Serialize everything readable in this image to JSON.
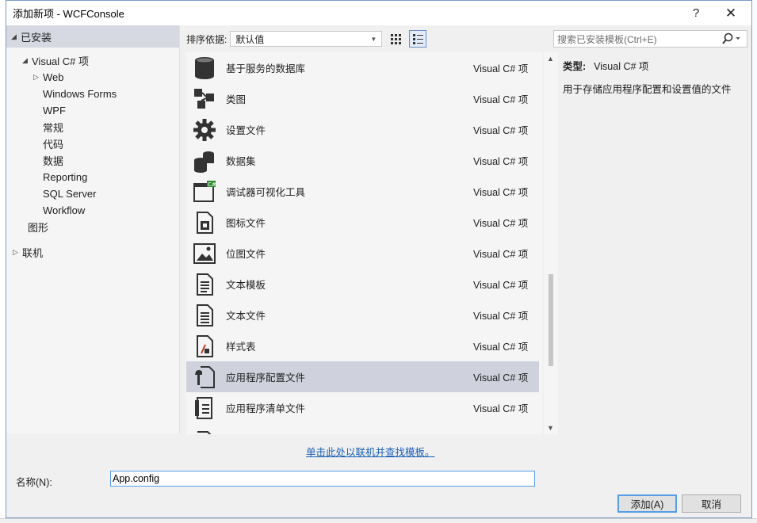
{
  "window": {
    "title": "添加新项 - WCFConsole",
    "help": "?",
    "close": "✕"
  },
  "tree": {
    "installed": "已安装",
    "visual_csharp": "Visual C# 项",
    "children": [
      "Web",
      "Windows Forms",
      "WPF",
      "常规",
      "代码",
      "数据",
      "Reporting",
      "SQL Server",
      "Workflow"
    ],
    "graphics": "图形",
    "online": "联机"
  },
  "sortbar": {
    "label": "排序依据:",
    "value": "默认值"
  },
  "search": {
    "placeholder": "搜索已安装模板(Ctrl+E)"
  },
  "items": [
    {
      "name": "基于服务的数据库",
      "type": "Visual C# 项",
      "icon": "database-icon"
    },
    {
      "name": "类图",
      "type": "Visual C# 项",
      "icon": "class-diagram-icon"
    },
    {
      "name": "设置文件",
      "type": "Visual C# 项",
      "icon": "gear-icon"
    },
    {
      "name": "数据集",
      "type": "Visual C# 项",
      "icon": "dataset-icon"
    },
    {
      "name": "调试器可视化工具",
      "type": "Visual C# 项",
      "icon": "visualizer-icon"
    },
    {
      "name": "图标文件",
      "type": "Visual C# 项",
      "icon": "icon-file-icon"
    },
    {
      "name": "位图文件",
      "type": "Visual C# 项",
      "icon": "bitmap-file-icon"
    },
    {
      "name": "文本模板",
      "type": "Visual C# 项",
      "icon": "text-template-icon"
    },
    {
      "name": "文本文件",
      "type": "Visual C# 项",
      "icon": "text-file-icon"
    },
    {
      "name": "样式表",
      "type": "Visual C# 项",
      "icon": "stylesheet-icon"
    },
    {
      "name": "应用程序配置文件",
      "type": "Visual C# 项",
      "icon": "app-config-icon",
      "selected": true
    },
    {
      "name": "应用程序清单文件",
      "type": "Visual C# 项",
      "icon": "manifest-icon"
    }
  ],
  "details": {
    "type_label": "类型:",
    "type_value": "Visual C# 项",
    "description": "用于存储应用程序配置和设置值的文件"
  },
  "online_link": "单击此处以联机并查找模板。",
  "name_field": {
    "label": "名称(N):",
    "value": "App.config"
  },
  "buttons": {
    "add": "添加(A)",
    "cancel": "取消"
  }
}
